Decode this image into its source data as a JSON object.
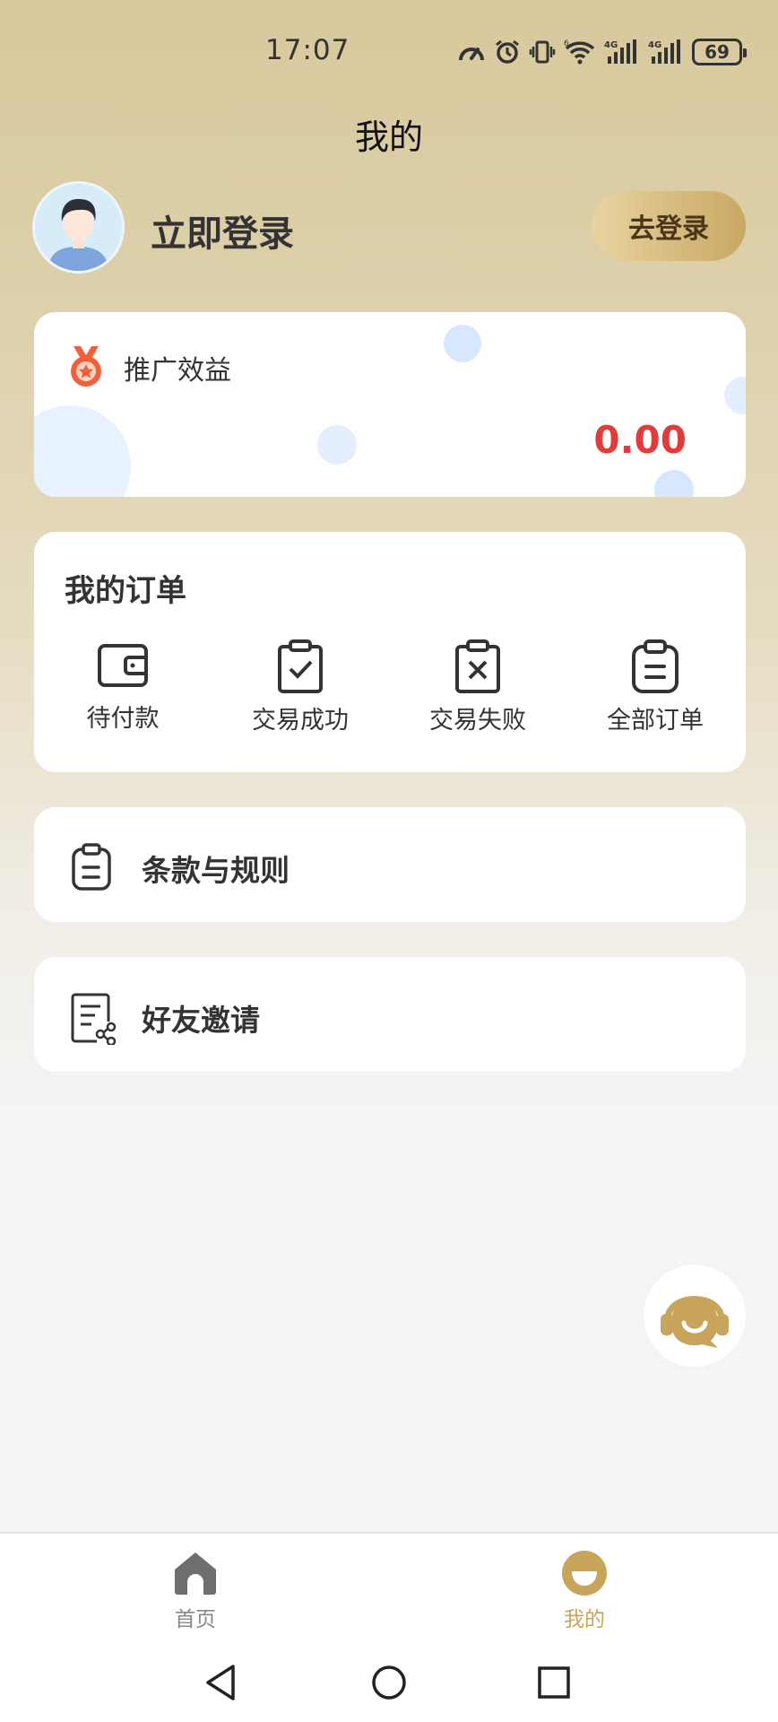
{
  "status_bar": {
    "time": "17:07",
    "battery": "69",
    "network_1": "4G",
    "network_2": "4G",
    "wifi_sup": "6",
    "icons": [
      "speed-meter-icon",
      "alarm-icon",
      "vibrate-icon",
      "wifi-icon",
      "signal-icon",
      "signal-icon",
      "battery-icon"
    ]
  },
  "header": {
    "title": "我的"
  },
  "profile": {
    "name": "立即登录",
    "login_button": "去登录"
  },
  "promo": {
    "title": "推广效益",
    "value": "0.00",
    "icon": "medal-icon",
    "value_color": "#e03c3c"
  },
  "orders": {
    "title": "我的订单",
    "items": [
      {
        "label": "待付款",
        "icon": "wallet-icon"
      },
      {
        "label": "交易成功",
        "icon": "clipboard-check-icon"
      },
      {
        "label": "交易失败",
        "icon": "clipboard-x-icon"
      },
      {
        "label": "全部订单",
        "icon": "clipboard-list-icon"
      }
    ]
  },
  "menu": [
    {
      "label": "条款与规则",
      "icon": "clipboard-icon"
    },
    {
      "label": "好友邀请",
      "icon": "document-share-icon"
    }
  ],
  "tabbar": {
    "items": [
      {
        "label": "首页",
        "icon": "home-icon",
        "active": false
      },
      {
        "label": "我的",
        "icon": "mine-icon",
        "active": true
      }
    ],
    "active_color": "#c9a55c"
  },
  "system_nav": [
    "back-icon",
    "home-circle-icon",
    "recents-icon"
  ],
  "colors": {
    "accent": "#c9a55c",
    "card_bg": "#ffffff",
    "value_red": "#e03c3c"
  }
}
